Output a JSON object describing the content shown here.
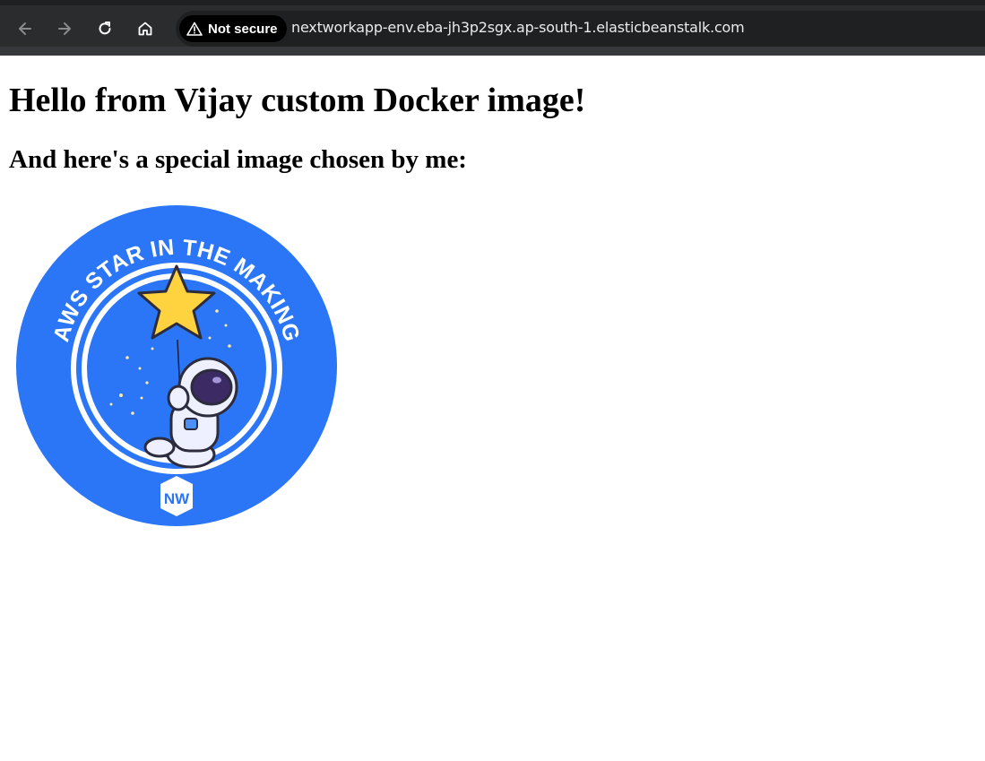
{
  "browser": {
    "security_label": "Not secure",
    "url": "nextworkapp-env.eba-jh3p2sgx.ap-south-1.elasticbeanstalk.com",
    "icons": {
      "back": "arrow-left-icon",
      "forward": "arrow-right-icon",
      "reload": "reload-icon",
      "home": "home-icon",
      "warning": "warning-triangle-icon"
    }
  },
  "page": {
    "heading": "Hello from Vijay custom Docker image!",
    "subheading": "And here's a special image chosen by me:",
    "badge": {
      "arc_text": "AWS STAR IN THE MAKING",
      "logo_text": "NW",
      "primary_color": "#2a76f6",
      "star_color": "#ffd23f"
    }
  }
}
